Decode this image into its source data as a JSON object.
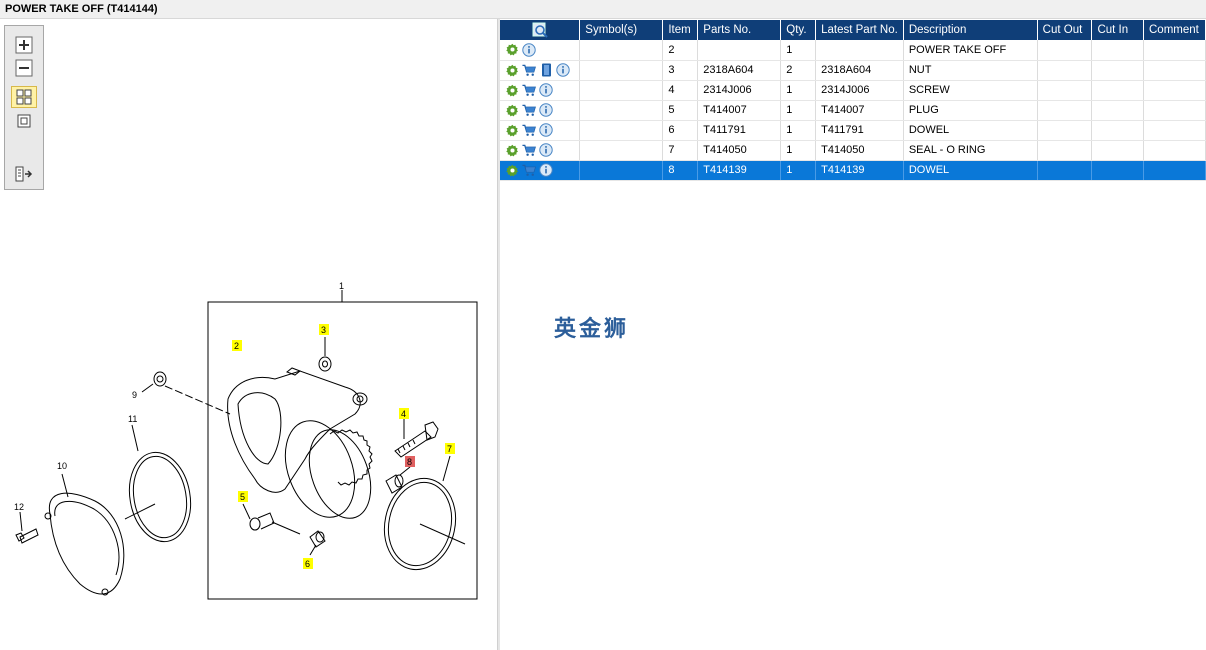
{
  "window": {
    "title": "POWER TAKE OFF (T414144)"
  },
  "toolbar": {
    "buttons": [
      {
        "name": "zoom-in",
        "icon": "plus-icon"
      },
      {
        "name": "zoom-out",
        "icon": "minus-icon"
      },
      {
        "name": "fit-all",
        "icon": "grid-icon",
        "active": true
      },
      {
        "name": "fit-window",
        "icon": "square-icon"
      },
      {
        "name": "export",
        "icon": "export-icon"
      }
    ]
  },
  "diagram": {
    "callouts": [
      "1",
      "2",
      "3",
      "4",
      "5",
      "6",
      "7",
      "8",
      "9",
      "10",
      "11",
      "12"
    ]
  },
  "table": {
    "headers": {
      "search": "",
      "symbols": "Symbol(s)",
      "item": "Item",
      "parts_no": "Parts No.",
      "qty": "Qty.",
      "latest_part_no": "Latest Part No.",
      "description": "Description",
      "cut_out": "Cut Out",
      "cut_in": "Cut In",
      "comment": "Comment"
    },
    "rows": [
      {
        "icons": [
          "gear",
          "info"
        ],
        "symbols": "",
        "item": "2",
        "parts_no": "",
        "qty": "1",
        "latest": "",
        "description": "POWER TAKE OFF",
        "cut_out": "",
        "cut_in": "",
        "comment": ""
      },
      {
        "icons": [
          "gear",
          "cart",
          "book",
          "info"
        ],
        "symbols": "",
        "item": "3",
        "parts_no": "2318A604",
        "qty": "2",
        "latest": "2318A604",
        "description": "NUT",
        "cut_out": "",
        "cut_in": "",
        "comment": ""
      },
      {
        "icons": [
          "gear",
          "cart",
          "info"
        ],
        "symbols": "",
        "item": "4",
        "parts_no": "2314J006",
        "qty": "1",
        "latest": "2314J006",
        "description": "SCREW",
        "cut_out": "",
        "cut_in": "",
        "comment": ""
      },
      {
        "icons": [
          "gear",
          "cart",
          "info"
        ],
        "symbols": "",
        "item": "5",
        "parts_no": "T414007",
        "qty": "1",
        "latest": "T414007",
        "description": "PLUG",
        "cut_out": "",
        "cut_in": "",
        "comment": ""
      },
      {
        "icons": [
          "gear",
          "cart",
          "info"
        ],
        "symbols": "",
        "item": "6",
        "parts_no": "T411791",
        "qty": "1",
        "latest": "T411791",
        "description": "DOWEL",
        "cut_out": "",
        "cut_in": "",
        "comment": ""
      },
      {
        "icons": [
          "gear",
          "cart",
          "info"
        ],
        "symbols": "",
        "item": "7",
        "parts_no": "T414050",
        "qty": "1",
        "latest": "T414050",
        "description": "SEAL - O RING",
        "cut_out": "",
        "cut_in": "",
        "comment": ""
      },
      {
        "icons": [
          "gear",
          "cart",
          "info"
        ],
        "symbols": "",
        "item": "8",
        "parts_no": "T414139",
        "qty": "1",
        "latest": "T414139",
        "description": "DOWEL",
        "cut_out": "",
        "cut_in": "",
        "comment": "",
        "selected": true
      }
    ]
  },
  "watermark": {
    "text": "英金狮"
  },
  "colors": {
    "header_bg": "#0f3e78",
    "selected_row": "#0a78d8",
    "callout_yellow": "#ffff00",
    "callout_red": "#e06060"
  }
}
